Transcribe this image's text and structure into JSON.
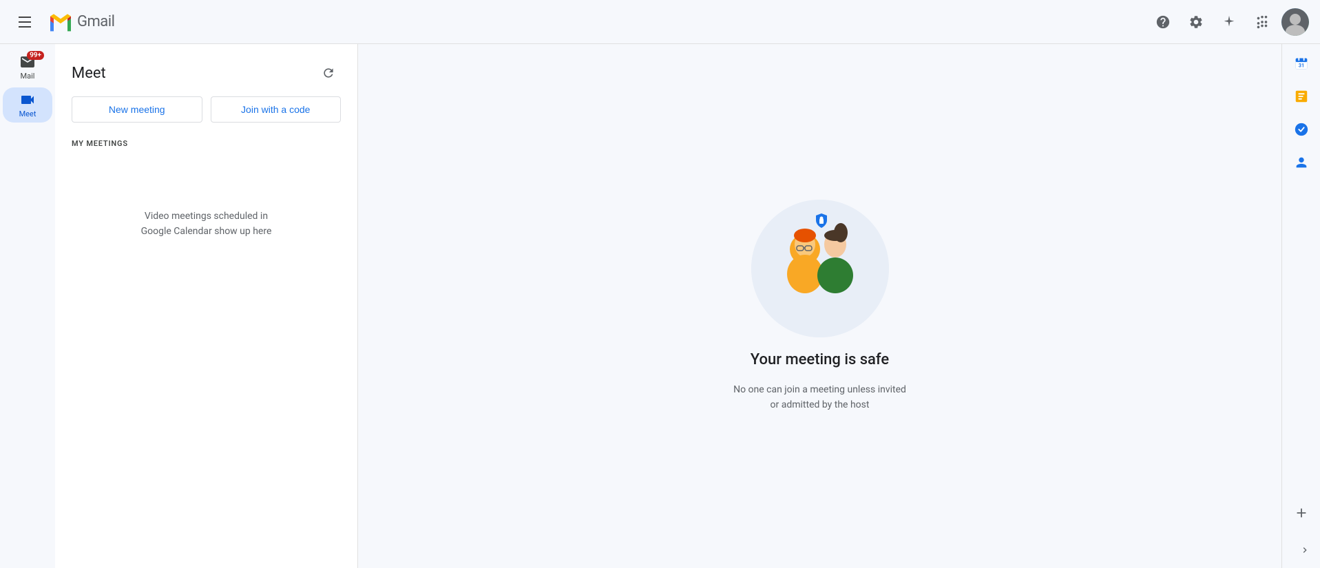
{
  "header": {
    "app_name": "Gmail",
    "help_icon": "help-circle-icon",
    "settings_icon": "gear-icon",
    "sparkle_icon": "sparkle-icon",
    "apps_icon": "grid-icon",
    "avatar_alt": "user-avatar"
  },
  "sidebar": {
    "items": [
      {
        "id": "mail",
        "label": "Mail",
        "icon": "mail-icon",
        "badge": "99+",
        "active": false
      },
      {
        "id": "meet",
        "label": "Meet",
        "icon": "video-icon",
        "badge": null,
        "active": true
      }
    ]
  },
  "meet_panel": {
    "title": "Meet",
    "refresh_label": "Refresh",
    "buttons": [
      {
        "id": "new-meeting",
        "label": "New meeting"
      },
      {
        "id": "join-code",
        "label": "Join with a code"
      }
    ],
    "my_meetings_label": "MY MEETINGS",
    "empty_text": "Video meetings scheduled in\nGoogle Calendar show up here"
  },
  "main_content": {
    "illustration_alt": "two people with security shield",
    "heading": "Your meeting is safe",
    "description": "No one can join a meeting unless invited\nor admitted by the host"
  },
  "right_panel": {
    "icons": [
      {
        "id": "calendar",
        "icon": "calendar-icon"
      },
      {
        "id": "tasks",
        "icon": "tasks-icon"
      },
      {
        "id": "todo",
        "icon": "todo-icon"
      },
      {
        "id": "contacts",
        "icon": "contacts-icon"
      }
    ],
    "add_label": "+",
    "expand_label": "›"
  }
}
